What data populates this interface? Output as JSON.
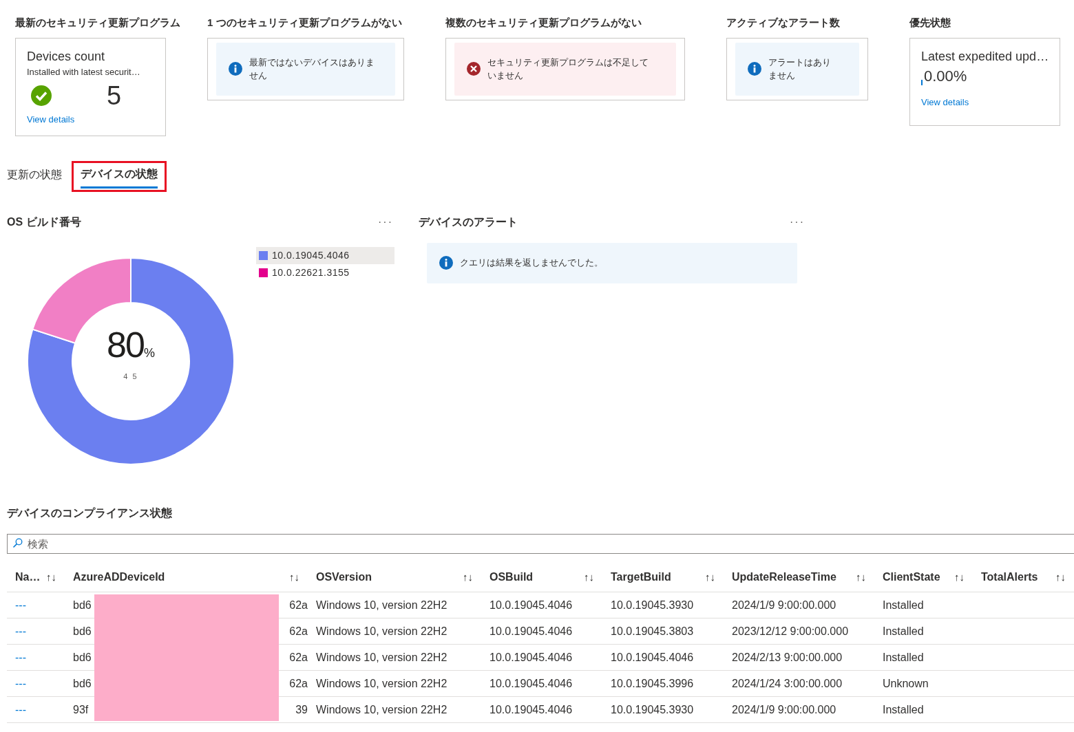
{
  "tiles": [
    {
      "heading": "最新のセキュリティ更新プログラム",
      "kind": "count",
      "title": "Devices count",
      "subtitle": "Installed with latest securit…",
      "value": "5",
      "link": "View details"
    },
    {
      "heading": "1 つのセキュリティ更新プログラムがない",
      "kind": "info",
      "message": "最新ではないデバイスはありません"
    },
    {
      "heading": "複数のセキュリティ更新プログラムがない",
      "kind": "error",
      "message": "セキュリティ更新プログラムは不足していません"
    },
    {
      "heading": "アクティブなアラート数",
      "kind": "info",
      "message": "アラートはありません"
    },
    {
      "heading": "優先状態",
      "kind": "percent",
      "title": "Latest expedited upd…",
      "value": "0.00%",
      "link": "View details"
    }
  ],
  "tabs": [
    {
      "label": "更新の状態",
      "selected": false
    },
    {
      "label": "デバイスの状態",
      "selected": true
    }
  ],
  "os_build": {
    "menu": "···",
    "center_value": "80",
    "center_unit": "%",
    "center_caption": "4 5",
    "legend_items": [
      {
        "color": "#6b7ff0",
        "selected": true
      },
      {
        "color": "#e3008c",
        "selected": false
      }
    ],
    "chart_data": {
      "type": "donut",
      "title": "OS ビルド番号",
      "categories": [
        "10.0.19045.4046",
        "10.0.22621.3155"
      ],
      "series": [
        {
          "values": [
            80,
            20
          ]
        }
      ],
      "legend": "right"
    }
  },
  "alerts": {
    "title": "デバイスのアラート",
    "menu": "···",
    "message": "クエリは結果を返しませんでした。"
  },
  "compliance": {
    "title": "デバイスのコンプライアンス状態",
    "search": {
      "placeholder": "検索"
    },
    "columns": [
      "Na…",
      "AzureADDeviceId",
      "OSVersion",
      "OSBuild",
      "TargetBuild",
      "UpdateReleaseTime",
      "ClientState",
      "TotalAlerts"
    ],
    "sort_icon": "↑↓",
    "rows": [
      {
        "name": "---",
        "id_start": "bd6",
        "id_end": "62a",
        "os_version": "Windows 10, version 22H2",
        "os_build": "10.0.19045.4046",
        "target_build": "10.0.19045.3930",
        "release_time": "2024/1/9 9:00:00.000",
        "client_state": "Installed"
      },
      {
        "name": "---",
        "id_start": "bd6",
        "id_end": "62a",
        "os_version": "Windows 10, version 22H2",
        "os_build": "10.0.19045.4046",
        "target_build": "10.0.19045.3803",
        "release_time": "2023/12/12 9:00:00.000",
        "client_state": "Installed"
      },
      {
        "name": "---",
        "id_start": "bd6",
        "id_end": "62a",
        "os_version": "Windows 10, version 22H2",
        "os_build": "10.0.19045.4046",
        "target_build": "10.0.19045.4046",
        "release_time": "2024/2/13 9:00:00.000",
        "client_state": "Installed"
      },
      {
        "name": "---",
        "id_start": "bd6",
        "id_end": "62a",
        "os_version": "Windows 10, version 22H2",
        "os_build": "10.0.19045.4046",
        "target_build": "10.0.19045.3996",
        "release_time": "2024/1/24 3:00:00.000",
        "client_state": "Unknown"
      },
      {
        "name": "---",
        "id_start": "93f",
        "id_end": "39",
        "os_version": "Windows 10, version 22H2",
        "os_build": "10.0.19045.4046",
        "target_build": "10.0.19045.3930",
        "release_time": "2024/1/9 9:00:00.000",
        "client_state": "Installed"
      }
    ]
  }
}
